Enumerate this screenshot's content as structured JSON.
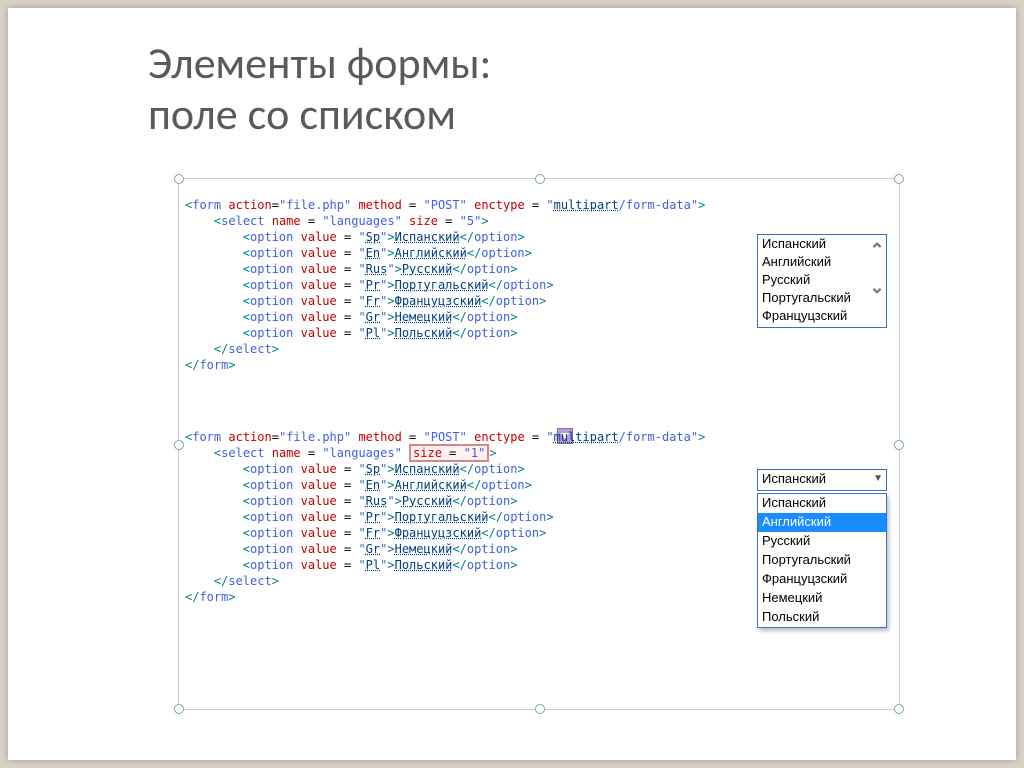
{
  "title": {
    "line1": "Элементы формы:",
    "line2": "поле со списком"
  },
  "code1": {
    "action": "file.php",
    "method": "POST",
    "enctype": "multipart/form-data",
    "select_name": "languages",
    "select_size": "5",
    "options": [
      {
        "val": "Sp",
        "label": "Испанский"
      },
      {
        "val": "En",
        "label": "Английский"
      },
      {
        "val": "Rus",
        "label": "Русский"
      },
      {
        "val": "Pr",
        "label": "Португальский"
      },
      {
        "val": "Fr",
        "label": "Француцзский"
      },
      {
        "val": "Gr",
        "label": "Немецкий"
      },
      {
        "val": "Pl",
        "label": "Польский"
      }
    ]
  },
  "code2": {
    "action": "file.php",
    "method": "POST",
    "enctype": "multipart/form-data",
    "select_name": "languages",
    "select_size": "1",
    "options": [
      {
        "val": "Sp",
        "label": "Испанский"
      },
      {
        "val": "En",
        "label": "Английский"
      },
      {
        "val": "Rus",
        "label": "Русский"
      },
      {
        "val": "Pr",
        "label": "Португальский"
      },
      {
        "val": "Fr",
        "label": "Француцзский"
      },
      {
        "val": "Gr",
        "label": "Немецкий"
      },
      {
        "val": "Pl",
        "label": "Польский"
      }
    ]
  },
  "listbox1": {
    "visible": [
      "Испанский",
      "Английский",
      "Русский",
      "Португальский",
      "Француцзский"
    ]
  },
  "dropdown2": {
    "selected": "Испанский",
    "highlighted": "Английский",
    "items": [
      "Испанский",
      "Английский",
      "Русский",
      "Португальский",
      "Француцзский",
      "Немецкий",
      "Польский"
    ]
  }
}
